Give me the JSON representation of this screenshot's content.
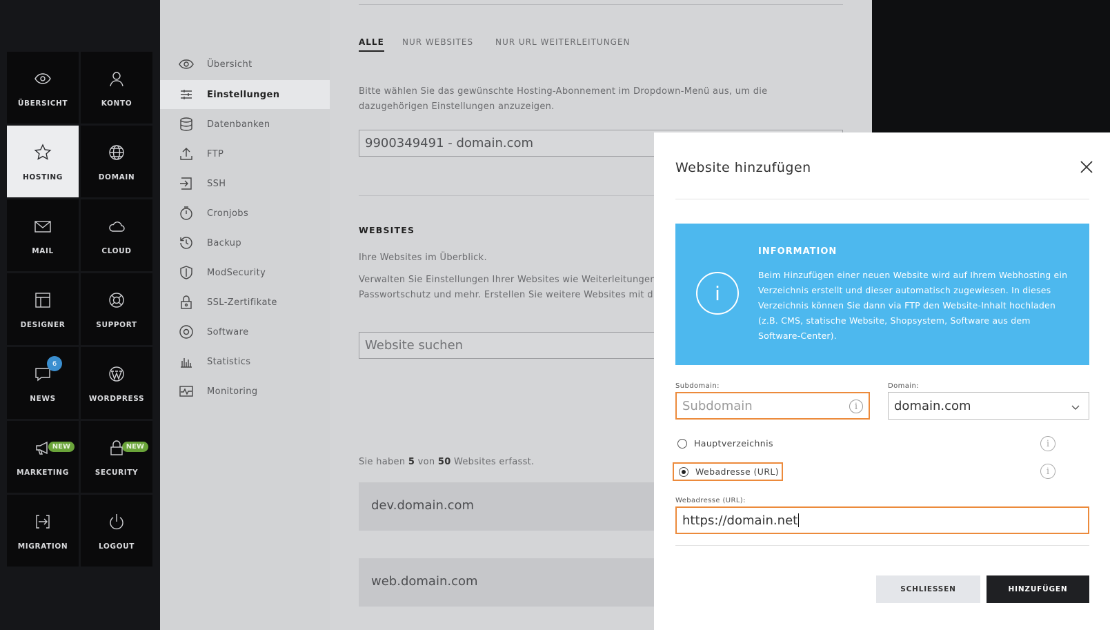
{
  "tile_menu": [
    {
      "label": "ÜBERSICHT",
      "icon": "eye-icon"
    },
    {
      "label": "KONTO",
      "icon": "user-icon"
    },
    {
      "label": "HOSTING",
      "icon": "star-icon",
      "active": true
    },
    {
      "label": "DOMAIN",
      "icon": "globe-icon"
    },
    {
      "label": "MAIL",
      "icon": "envelope-icon"
    },
    {
      "label": "CLOUD",
      "icon": "cloud-icon"
    },
    {
      "label": "DESIGNER",
      "icon": "layout-icon"
    },
    {
      "label": "SUPPORT",
      "icon": "lifebuoy-icon"
    },
    {
      "label": "NEWS",
      "icon": "chat-icon",
      "badge": "6"
    },
    {
      "label": "WORDPRESS",
      "icon": "wordpress-icon"
    },
    {
      "label": "MARKETING",
      "icon": "megaphone-icon",
      "badge": "NEW"
    },
    {
      "label": "SECURITY",
      "icon": "lock-icon",
      "badge": "NEW"
    },
    {
      "label": "MIGRATION",
      "icon": "migration-icon"
    },
    {
      "label": "LOGOUT",
      "icon": "power-icon"
    }
  ],
  "subnav": [
    {
      "label": "Übersicht",
      "icon": "eye-icon"
    },
    {
      "label": "Einstellungen",
      "icon": "sliders-icon",
      "active": true
    },
    {
      "label": "Datenbanken",
      "icon": "database-icon"
    },
    {
      "label": "FTP",
      "icon": "upload-icon"
    },
    {
      "label": "SSH",
      "icon": "login-icon"
    },
    {
      "label": "Cronjobs",
      "icon": "stopwatch-icon"
    },
    {
      "label": "Backup",
      "icon": "history-icon"
    },
    {
      "label": "ModSecurity",
      "icon": "shield-icon"
    },
    {
      "label": "SSL-Zertifikate",
      "icon": "padlock-icon"
    },
    {
      "label": "Software",
      "icon": "disc-icon"
    },
    {
      "label": "Statistics",
      "icon": "bar-chart-icon"
    },
    {
      "label": "Monitoring",
      "icon": "pulse-icon"
    }
  ],
  "main": {
    "tabs": [
      "ALLE",
      "NUR WEBSITES",
      "NUR URL WEITERLEITUNGEN"
    ],
    "intro_line1": "Bitte wählen Sie das gewünschte Hosting-Abonnement im Dropdown-Menü aus, um die",
    "intro_line2": "dazugehörigen Einstellungen anzuzeigen.",
    "subscription_value": "9900349491 - domain.com",
    "websites_heading": "WEBSITES",
    "websites_sub": "Ihre Websites im Überblick.",
    "websites_desc1": "Verwalten Sie Einstellungen Ihrer Websites wie Weiterleitungen",
    "websites_desc2": "Passwortschutz und mehr. Erstellen Sie weitere Websites mit d",
    "search_placeholder": "Website suchen",
    "count_pre": "Sie haben ",
    "count_have": "5",
    "count_mid": " von ",
    "count_max": "50",
    "count_post": " Websites erfasst.",
    "sites": [
      "dev.domain.com",
      "web.domain.com"
    ]
  },
  "modal": {
    "title": "Website hinzufügen",
    "info_heading": "INFORMATION",
    "info_icon_glyph": "i",
    "info_text": "Beim Hinzufügen einer neuen Website wird auf Ihrem Webhosting ein Verzeichnis erstellt und dieser automatisch zugewiesen. In dieses Verzeichnis können Sie dann via FTP den Website-Inhalt hochladen (z.B. CMS, statische Website, Shopsystem, Software aus dem Software-Center).",
    "subdomain_label": "Subdomain:",
    "subdomain_placeholder": "Subdomain",
    "domain_label": "Domain:",
    "domain_value": "domain.com",
    "radio_main_dir": "Hauptverzeichnis",
    "radio_url": "Webadresse (URL)",
    "url_label": "Webadresse (URL):",
    "url_value": "https://domain.net",
    "close_button": "SCHLIESSEN",
    "add_button": "HINZUFÜGEN",
    "highlight_color": "#ec8a3b",
    "info_color": "#4db8ee"
  }
}
